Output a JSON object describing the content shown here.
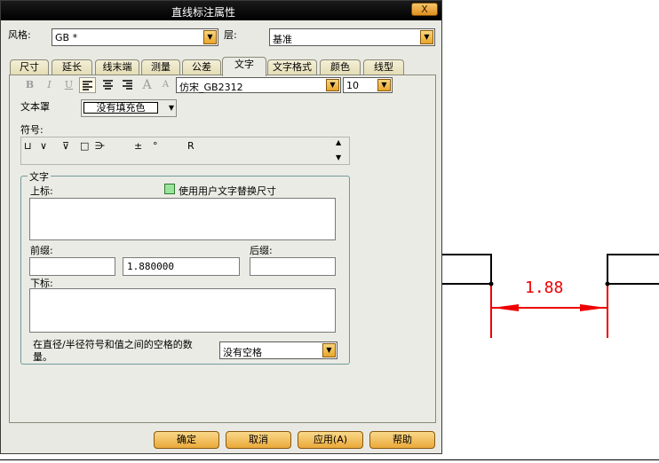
{
  "window": {
    "title": "直线标注属性",
    "close_label": "X"
  },
  "style_row": {
    "style_label": "风格:",
    "style_value": "GB *",
    "layer_label": "层:",
    "layer_value": "基准"
  },
  "tabs": [
    {
      "label": "尺寸"
    },
    {
      "label": "延长"
    },
    {
      "label": "线末端"
    },
    {
      "label": "测量"
    },
    {
      "label": "公差"
    },
    {
      "label": "文字"
    },
    {
      "label": "文字格式"
    },
    {
      "label": "颜色"
    },
    {
      "label": "线型"
    }
  ],
  "active_tab": "文字",
  "toolbar": {
    "bold": "B",
    "italic": "I",
    "underline": "U",
    "font_value": "仿宋_GB2312",
    "size_value": "10"
  },
  "frame": {
    "label": "文本罩",
    "value": "没有填充色"
  },
  "symbols": {
    "label": "符号:",
    "items": [
      "⊔",
      "∨",
      "⊽",
      "□",
      "⋺",
      "±",
      "°",
      "R"
    ]
  },
  "text_group": {
    "title": "文字",
    "upper_label": "上标:",
    "checkbox_label": "使用用户文字替换尺寸",
    "prefix_label": "前缀:",
    "value_field": "1.880000",
    "suffix_label": "后缀:",
    "lower_label": "下标:",
    "spacing_label_line1": "在直径/半径符号和值之间的空格的数",
    "spacing_label_line2": "量。",
    "spacing_value": "没有空格"
  },
  "buttons": {
    "ok": "确定",
    "cancel": "取消",
    "apply": "应用(A)",
    "help": "帮助"
  },
  "drawing": {
    "dimension_text": "1.88",
    "dim_color": "#ee0000"
  }
}
